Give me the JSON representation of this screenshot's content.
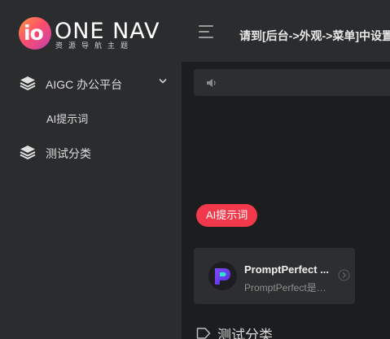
{
  "brand": {
    "badge_text": "io",
    "name": "ONE NAV",
    "tagline": "资源导航主题"
  },
  "header": {
    "notice": "请到[后台->外观->菜单]中设置"
  },
  "sidebar": {
    "items": [
      {
        "label": "AIGC 办公平台",
        "icon": "layers-icon",
        "expanded": true
      },
      {
        "label": "测试分类",
        "icon": "layers-icon"
      }
    ],
    "subitems": [
      {
        "label": "AI提示词"
      }
    ]
  },
  "main": {
    "notice_icon": "speaker-icon",
    "tag": "AI提示词",
    "cards": [
      {
        "title": "PromptPerfect ...",
        "description": "PromptPerfect是什么?",
        "icon": "promptperfect-logo"
      }
    ],
    "section_title": "测试分类",
    "section_icon": "tag-icon"
  },
  "colors": {
    "topbar_bg": "#2a2c2e",
    "sidebar_bg": "#2a2c2e",
    "content_bg": "#1b1d1f",
    "card_bg": "#2c2e30",
    "accent_red": "#f2394b",
    "logo_gradient_start": "#ff9a3c",
    "logo_gradient_end": "#c13eb0"
  }
}
